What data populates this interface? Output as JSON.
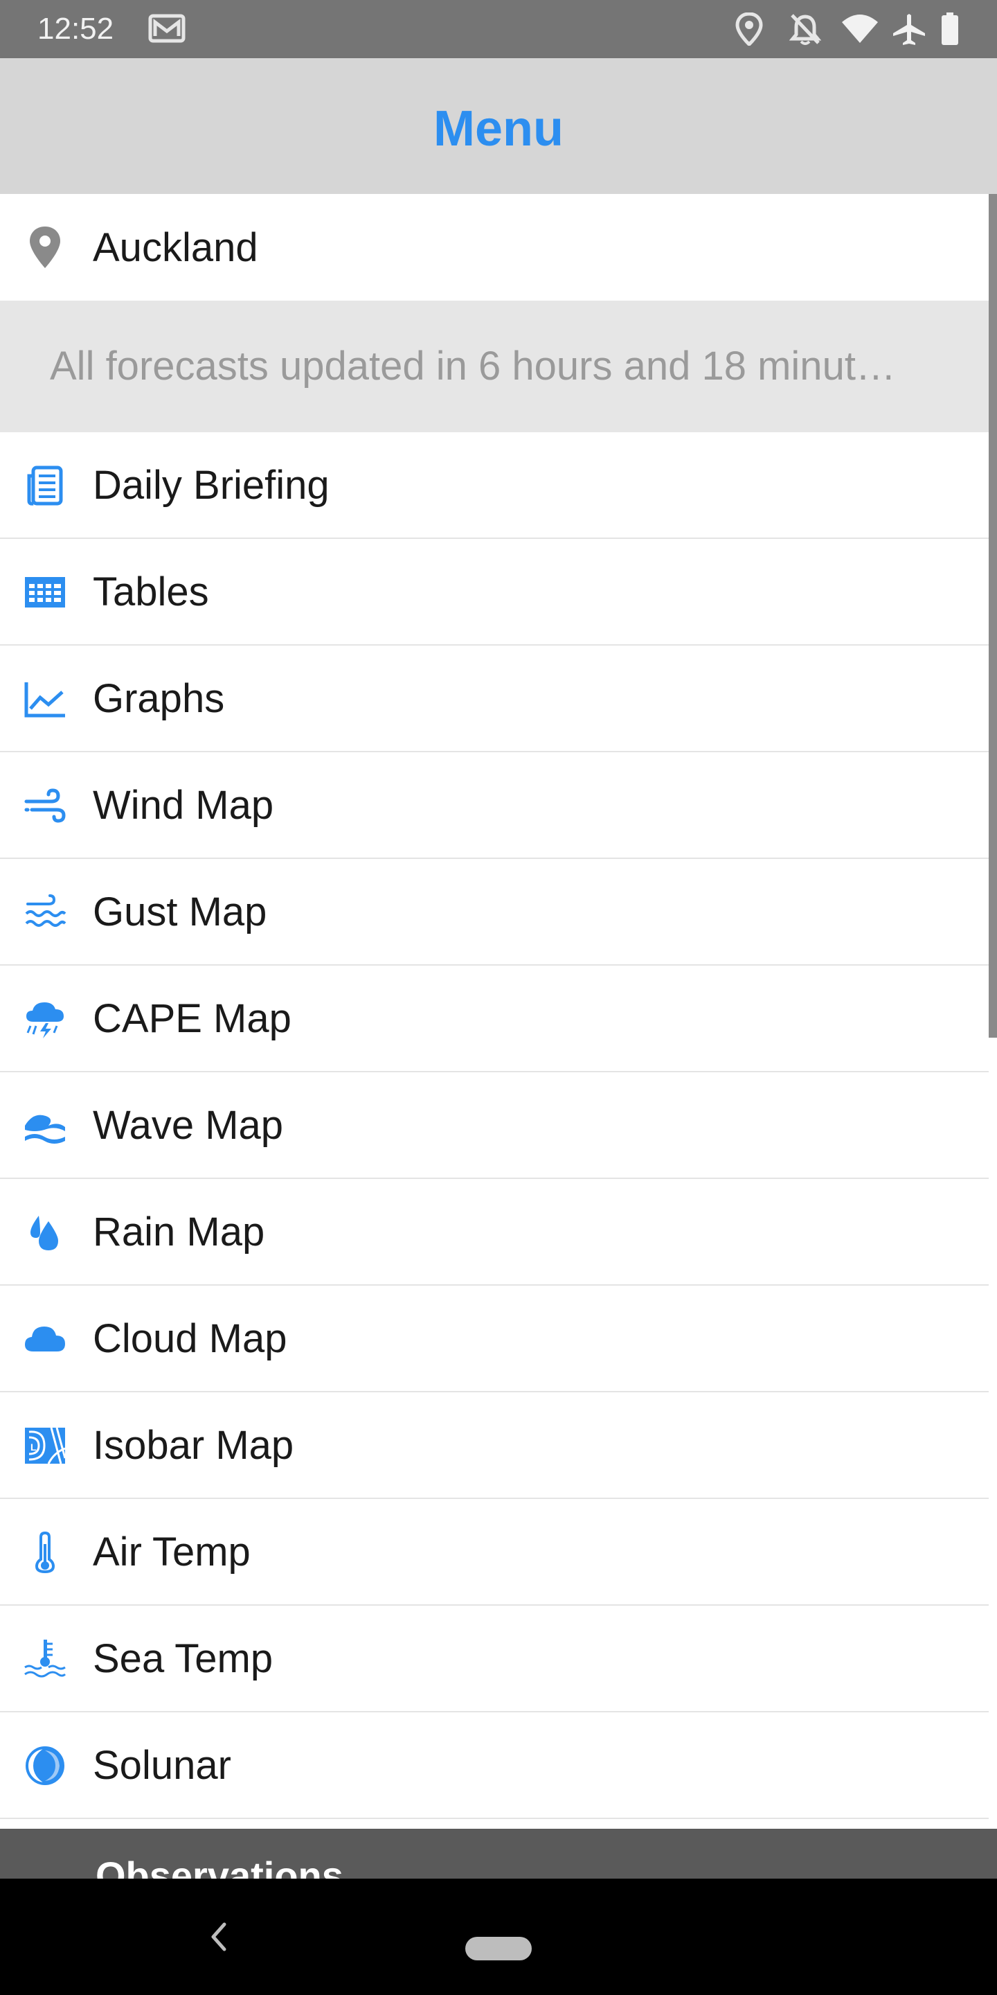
{
  "status_bar": {
    "time": "12:52",
    "icons": [
      "gmail-icon",
      "location-icon",
      "alarm-off-icon",
      "wifi-icon",
      "airplane-icon",
      "battery-icon"
    ]
  },
  "header": {
    "title": "Menu"
  },
  "location": {
    "name": "Auckland",
    "icon": "map-pin-icon"
  },
  "update_banner": {
    "text": "All forecasts updated in 6 hours and 18 minut…"
  },
  "menu": {
    "items": [
      {
        "label": "Daily Briefing",
        "icon": "newspaper-icon"
      },
      {
        "label": "Tables",
        "icon": "table-icon"
      },
      {
        "label": "Graphs",
        "icon": "line-chart-icon"
      },
      {
        "label": "Wind Map",
        "icon": "wind-icon"
      },
      {
        "label": "Gust Map",
        "icon": "gust-icon"
      },
      {
        "label": "CAPE Map",
        "icon": "thunderstorm-icon"
      },
      {
        "label": "Wave Map",
        "icon": "wave-icon"
      },
      {
        "label": "Rain Map",
        "icon": "raindrops-icon"
      },
      {
        "label": "Cloud Map",
        "icon": "cloud-icon"
      },
      {
        "label": "Isobar Map",
        "icon": "isobar-icon"
      },
      {
        "label": "Air Temp",
        "icon": "thermometer-icon"
      },
      {
        "label": "Sea Temp",
        "icon": "sea-thermometer-icon"
      },
      {
        "label": "Solunar",
        "icon": "moon-icon"
      }
    ]
  },
  "section": {
    "title": "Observations"
  },
  "colors": {
    "accent": "#2c8ef0",
    "header_bg": "#d6d6d6",
    "banner_bg": "#e6e6e6",
    "status_bg": "#757575"
  }
}
